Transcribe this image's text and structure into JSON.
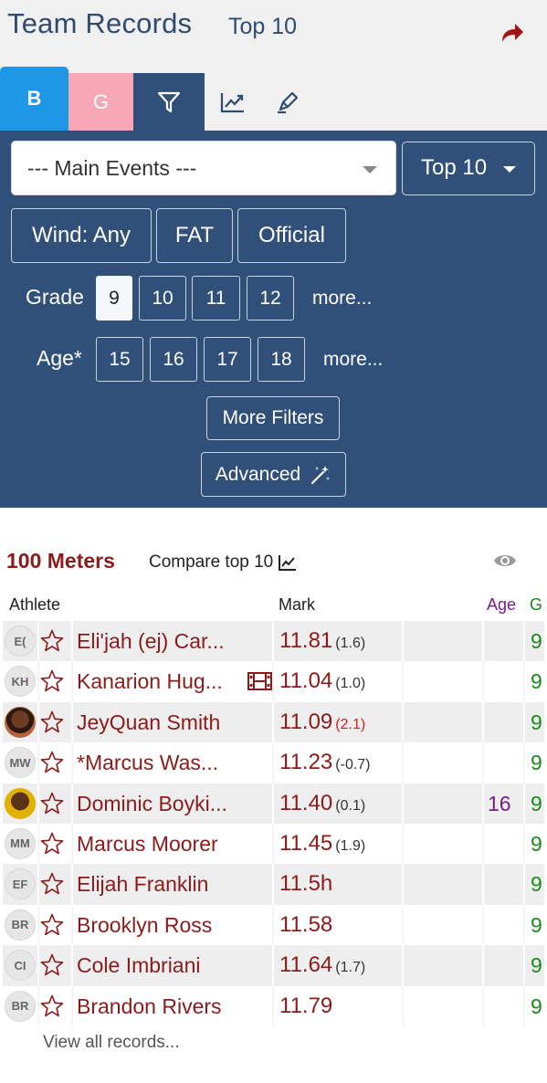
{
  "header": {
    "title": "Team Records",
    "subtitle": "Top 10",
    "share_icon": "share-icon"
  },
  "tabs": {
    "boys_label": "B",
    "girls_label": "G",
    "icons": [
      "filter-icon",
      "chart-line-icon",
      "pen-icon"
    ],
    "colors": {
      "boys": "#1e97e6",
      "girls": "#f7a7b6",
      "active": "#30507a"
    }
  },
  "filters": {
    "event_select": "--- Main Events ---",
    "top_select": "Top 10",
    "wind": "Wind: Any",
    "fat": "FAT",
    "official": "Official",
    "grade_label": "Grade",
    "grades": [
      "9",
      "10",
      "11",
      "12"
    ],
    "grade_selected": "9",
    "age_label": "Age*",
    "ages": [
      "15",
      "16",
      "17",
      "18"
    ],
    "more": "more...",
    "more_filters": "More Filters",
    "advanced": "Advanced"
  },
  "section": {
    "title": "100 Meters",
    "compare": "Compare top 10",
    "columns": {
      "athlete": "Athlete",
      "mark": "Mark",
      "age": "Age",
      "grade": "G"
    }
  },
  "rows": [
    {
      "initials": "E(",
      "name": "Eli'jah (ej) Car...",
      "mark": "11.81",
      "wind": "(1.6)",
      "wind_over": false,
      "film": false,
      "age": "",
      "grade": "9",
      "photo": ""
    },
    {
      "initials": "KH",
      "name": "Kanarion Hug...",
      "mark": "11.04",
      "wind": "(1.0)",
      "wind_over": false,
      "film": true,
      "age": "",
      "grade": "9",
      "photo": ""
    },
    {
      "initials": "",
      "name": "JeyQuan Smith",
      "mark": "11.09",
      "wind": "(2.1)",
      "wind_over": true,
      "film": false,
      "age": "",
      "grade": "9",
      "photo": "photo1"
    },
    {
      "initials": "MW",
      "name": "*Marcus Was...",
      "mark": "11.23",
      "wind": "(-0.7)",
      "wind_over": false,
      "film": false,
      "age": "",
      "grade": "9",
      "photo": ""
    },
    {
      "initials": "",
      "name": "Dominic Boyki...",
      "mark": "11.40",
      "wind": "(0.1)",
      "wind_over": false,
      "film": false,
      "age": "16",
      "grade": "9",
      "photo": "photo2"
    },
    {
      "initials": "MM",
      "name": "Marcus Moorer",
      "mark": "11.45",
      "wind": "(1.9)",
      "wind_over": false,
      "film": false,
      "age": "",
      "grade": "9",
      "photo": ""
    },
    {
      "initials": "EF",
      "name": "Elijah Franklin",
      "mark": "11.5h",
      "wind": "",
      "wind_over": false,
      "film": false,
      "age": "",
      "grade": "9",
      "photo": ""
    },
    {
      "initials": "BR",
      "name": "Brooklyn Ross",
      "mark": "11.58",
      "wind": "",
      "wind_over": false,
      "film": false,
      "age": "",
      "grade": "9",
      "photo": ""
    },
    {
      "initials": "CI",
      "name": "Cole Imbriani",
      "mark": "11.64",
      "wind": "(1.7)",
      "wind_over": false,
      "film": false,
      "age": "",
      "grade": "9",
      "photo": ""
    },
    {
      "initials": "BR",
      "name": "Brandon Rivers",
      "mark": "11.79",
      "wind": "",
      "wind_over": false,
      "film": false,
      "age": "",
      "grade": "9",
      "photo": ""
    }
  ],
  "footer": {
    "view_all": "View all records..."
  }
}
